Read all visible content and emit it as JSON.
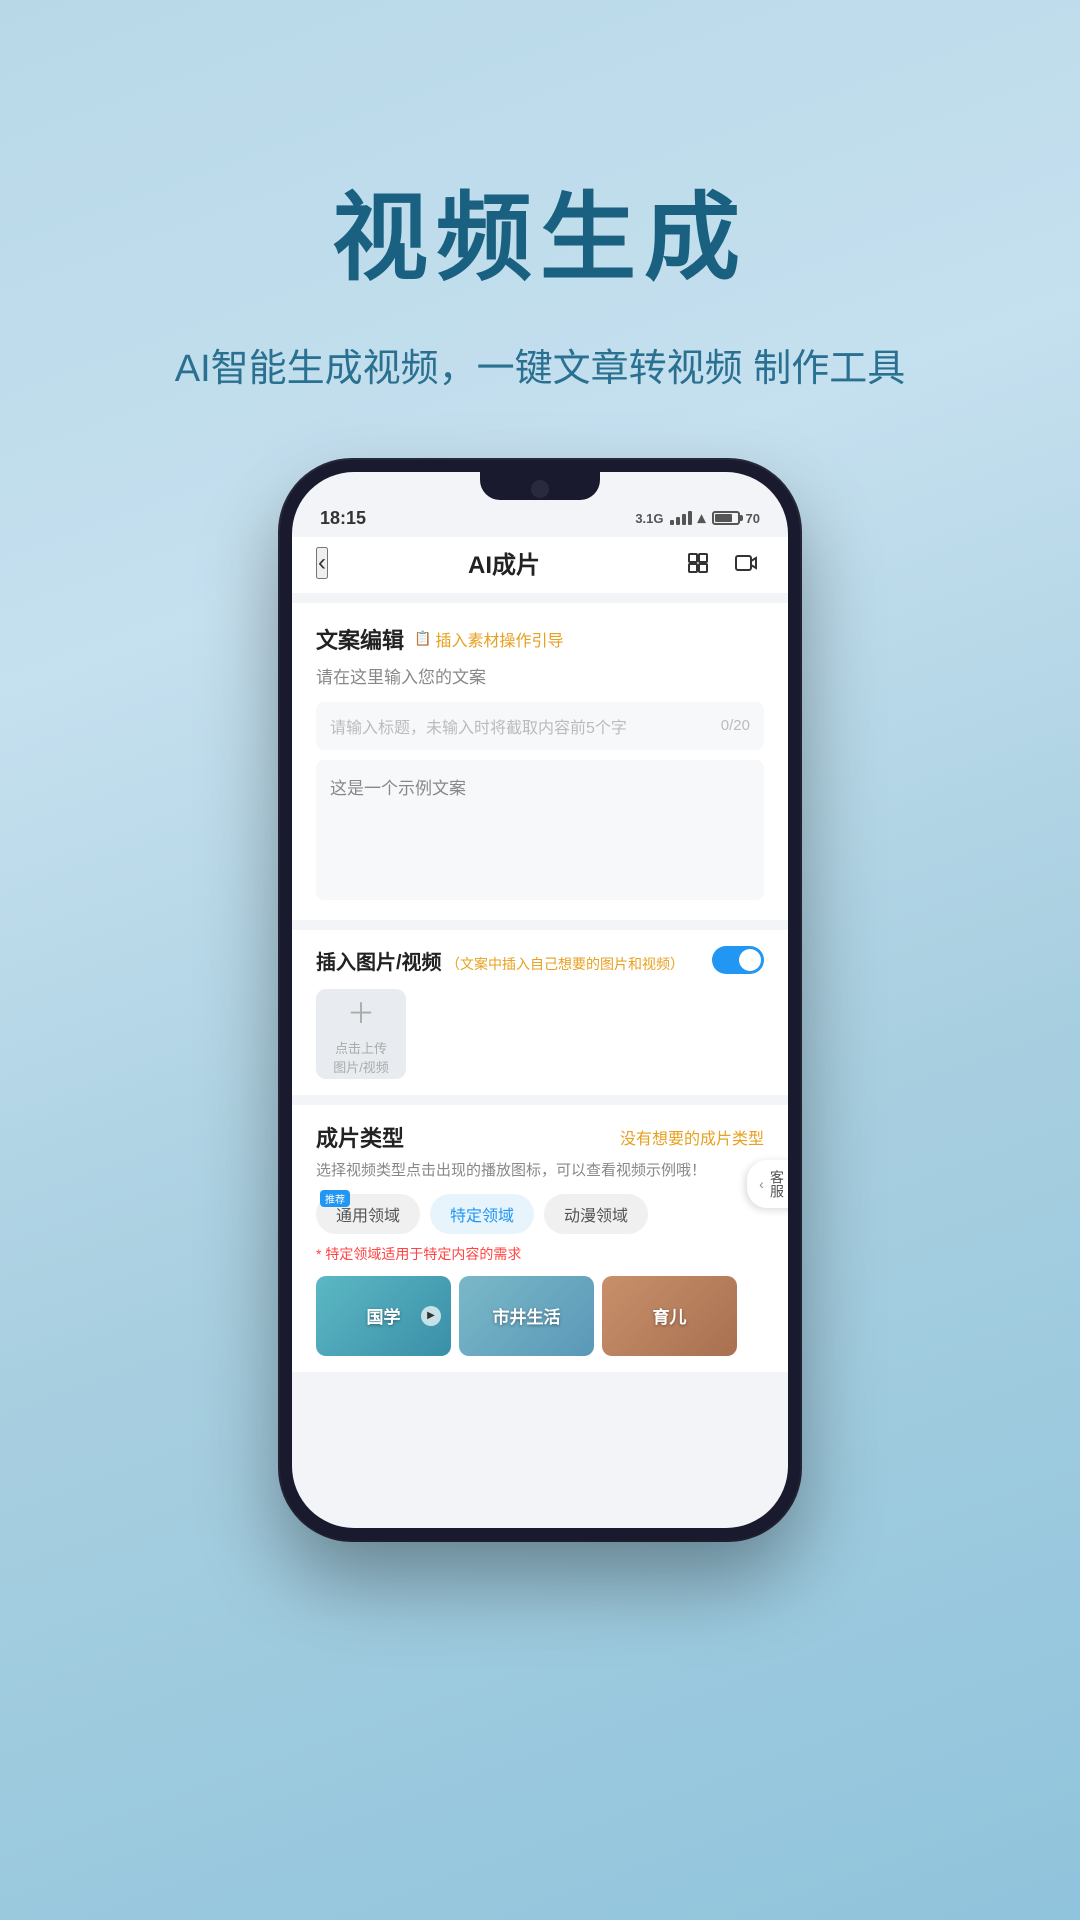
{
  "hero": {
    "title": "视频生成",
    "subtitle": "AI智能生成视频，一键文章转视频\n制作工具"
  },
  "statusBar": {
    "time": "18:15",
    "signal": "3.1G",
    "battery": "70"
  },
  "navBar": {
    "backLabel": "‹",
    "title": "AI成片"
  },
  "copySection": {
    "title": "文案编辑",
    "guideLabel": "插入素材操作引导",
    "desc": "请在这里输入您的文案",
    "titlePlaceholder": "请输入标题，未输入时将截取内容前5个字",
    "titleCount": "0/20",
    "contentPlaceholder": "这是一个示例文案"
  },
  "insertSection": {
    "label": "插入图片/视频",
    "sublabel": "（文案中插入自己想要的图片和视频）",
    "uploadText": "点击上传\n图片/视频"
  },
  "typeSection": {
    "title": "成片类型",
    "linkText": "没有想要的成片类型",
    "desc": "选择视频类型点击出现的播放图标，可以查看视频示例哦！",
    "tabs": [
      {
        "label": "通用领域",
        "badge": "推荐",
        "active": false
      },
      {
        "label": "特定领域",
        "badge": "",
        "active": true
      },
      {
        "label": "动漫领域",
        "badge": "",
        "active": false
      }
    ],
    "note": "* 特定领域适用于特定内容的需求",
    "categories": [
      {
        "label": "国学",
        "style": "cat-guoxue",
        "hasPlay": true
      },
      {
        "label": "市井生活",
        "style": "cat-shijing",
        "hasPlay": false
      },
      {
        "label": "育儿",
        "style": "cat-yuer",
        "hasPlay": false
      }
    ]
  },
  "customerBtn": {
    "arrow": "‹",
    "label": "客\n服"
  }
}
